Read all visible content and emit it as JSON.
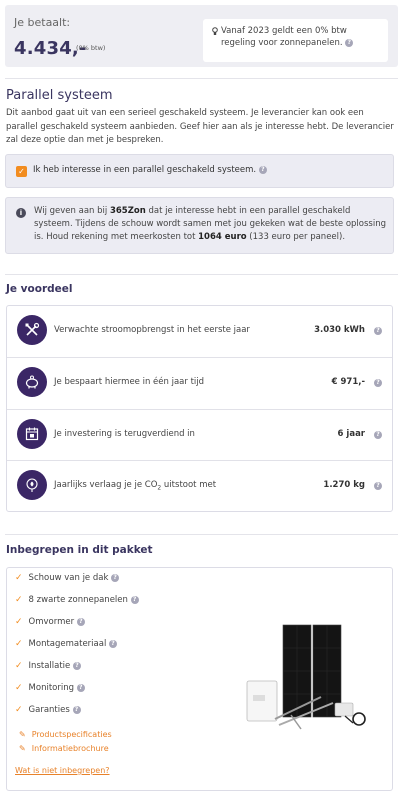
{
  "price": {
    "label": "Je betaalt:",
    "value": "4.434,-",
    "sub": "(0% btw)"
  },
  "btw_notice": {
    "text": "Vanaf 2023 geldt een 0% btw regeling voor zonnepanelen."
  },
  "parallel": {
    "title": "Parallel systeem",
    "intro": "Dit aanbod gaat uit van een serieel geschakeld systeem. Je leverancier kan ook een parallel geschakeld systeem aanbieden. Geef hier aan als je interesse hebt. De leverancier zal deze optie dan met je bespreken.",
    "checkbox_label": "Ik heb interesse in een parallel geschakeld systeem.",
    "checkbox_checked": true,
    "info_pre": "Wij geven aan bij ",
    "info_brand": "365Zon",
    "info_mid": " dat je interesse hebt in een parallel geschakeld systeem. Tijdens de schouw wordt samen met jou gekeken wat de beste oplossing is. Houd rekening met meerkosten tot ",
    "info_amount": "1064 euro",
    "info_post": " (133 euro per paneel)."
  },
  "benefits": {
    "title": "Je voordeel",
    "rows": [
      {
        "icon": "tools-icon",
        "label": "Verwachte stroomopbrengst in het eerste jaar",
        "value": "3.030 kWh"
      },
      {
        "icon": "piggy-bank-icon",
        "label": "Je bespaart hiermee in één jaar tijd",
        "value": "€ 971,-"
      },
      {
        "icon": "calendar-icon",
        "label": "Je investering is terugverdiend in",
        "value": "6 jaar"
      },
      {
        "icon": "leaf-icon",
        "label_pre": "Jaarlijks verlaag je je CO",
        "label_sub": "2",
        "label_post": " uitstoot met",
        "value": "1.270 kg"
      }
    ]
  },
  "package": {
    "title": "Inbegrepen in dit pakket",
    "items": [
      "Schouw van je dak",
      "8 zwarte zonnepanelen",
      "Omvormer",
      "Montagemateriaal",
      "Installatie",
      "Monitoring",
      "Garanties"
    ],
    "links": [
      "Productspecificaties",
      "Informatiebrochure"
    ],
    "not_included": "Wat is niet inbegrepen?"
  },
  "colors": {
    "accent": "#f28c1f",
    "brand": "#3b2766",
    "panel": "#eeeef3"
  }
}
